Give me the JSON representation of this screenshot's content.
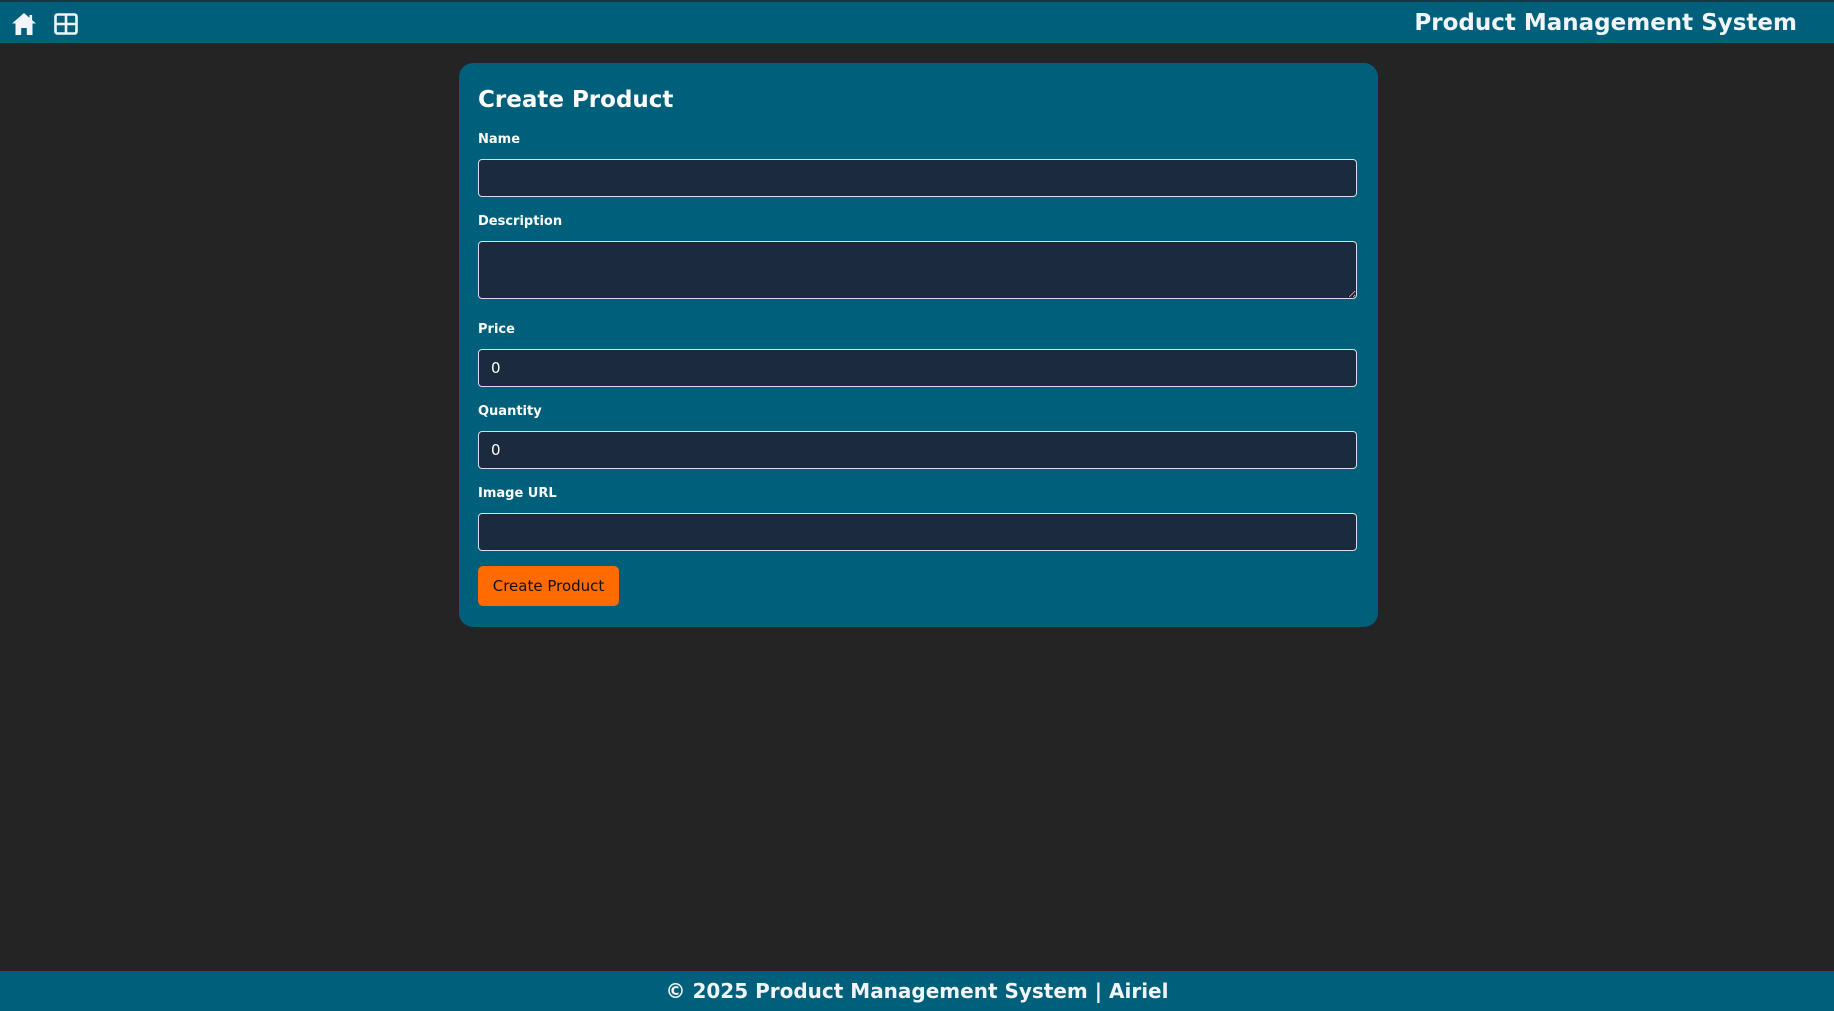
{
  "header": {
    "app_title": "Product Management System",
    "nav_icons": [
      "home-icon",
      "grid-icon"
    ]
  },
  "form": {
    "title": "Create Product",
    "fields": {
      "name": {
        "label": "Name",
        "value": ""
      },
      "description": {
        "label": "Description",
        "value": ""
      },
      "price": {
        "label": "Price",
        "value": "0"
      },
      "quantity": {
        "label": "Quantity",
        "value": "0"
      },
      "image_url": {
        "label": "Image URL",
        "value": ""
      }
    },
    "submit_label": "Create Product"
  },
  "footer": {
    "text": "© 2025 Product Management System | Airiel"
  },
  "colors": {
    "background": "#242424",
    "primary": "#005f7a",
    "input_background": "#1c2a40",
    "accent": "#ff6b00"
  }
}
